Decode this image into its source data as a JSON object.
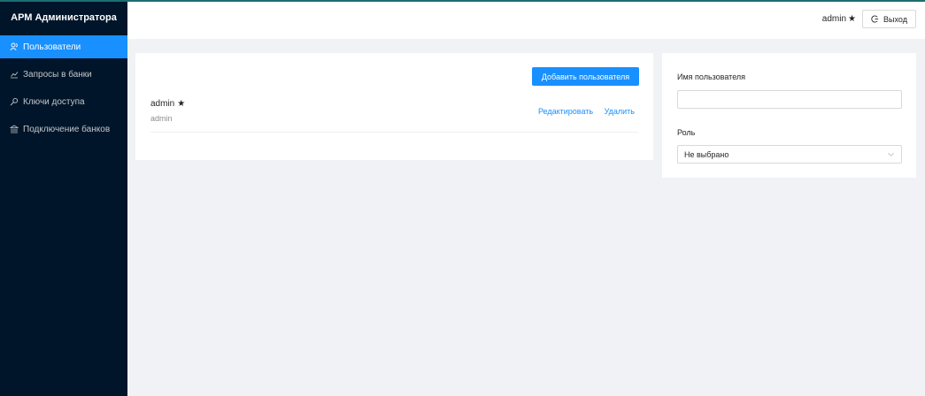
{
  "app": {
    "title": "АРМ Администратора"
  },
  "sidebar": {
    "items": [
      {
        "label": "Пользователи",
        "icon": "users-icon",
        "active": true
      },
      {
        "label": "Запросы в банки",
        "icon": "line-chart-icon",
        "active": false
      },
      {
        "label": "Ключи доступа",
        "icon": "key-icon",
        "active": false
      },
      {
        "label": "Подключение банков",
        "icon": "bank-icon",
        "active": false
      }
    ]
  },
  "header": {
    "username": "admin",
    "user_badge": "★",
    "logout_label": "Выход"
  },
  "users": {
    "add_label": "Добавить пользователя",
    "list": [
      {
        "name": "admin",
        "badge": "★",
        "description": "admin",
        "edit_label": "Редактировать",
        "delete_label": "Удалить"
      }
    ]
  },
  "filters": {
    "username_label": "Имя пользователя",
    "username_value": "",
    "role_label": "Роль",
    "role_value": "Не выбрано"
  },
  "colors": {
    "sidebar_bg": "#001529",
    "accent": "#1890ff",
    "page_bg": "#f0f2f5"
  }
}
